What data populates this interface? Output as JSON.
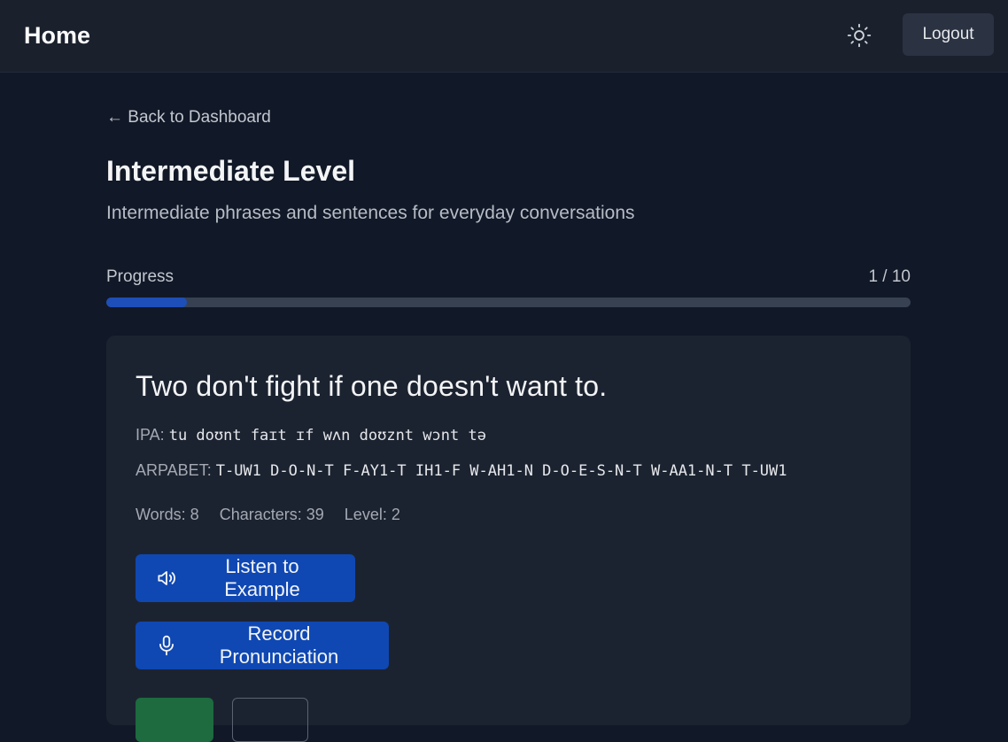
{
  "header": {
    "title": "Home",
    "theme_icon": "sun-icon",
    "logout_label": "Logout"
  },
  "nav": {
    "back_label": "← Back to Dashboard"
  },
  "page": {
    "title": "Intermediate Level",
    "subtitle": "Intermediate phrases and sentences for everyday conversations"
  },
  "progress": {
    "label": "Progress",
    "count_text": "1 / 10",
    "current": 1,
    "total": 10,
    "fraction": 0.1
  },
  "card": {
    "phrase": "Two don't fight if one doesn't want to.",
    "ipa_label": "IPA:",
    "ipa_value": "tu doʊnt faɪt ɪf wʌn doʊznt wɔnt tə",
    "arpabet_label": "ARPABET:",
    "arpabet_value": "T-UW1 D-O-N-T F-AY1-T IH1-F W-AH1-N D-O-E-S-N-T W-AA1-N-T T-UW1",
    "stats": {
      "words": "Words: 8",
      "characters": "Characters: 39",
      "level": "Level: 2"
    },
    "listen_label": "Listen to Example",
    "listen_icon": "speaker-icon",
    "record_label": "Record Pronunciation",
    "record_icon": "microphone-icon"
  },
  "colors": {
    "background": "#111827",
    "header_bg": "#1a202c",
    "card_bg": "#1c2330",
    "accent_blue": "#0f48b3",
    "progress_fill": "#1e4fb8",
    "success_green": "#1d6b3f"
  }
}
